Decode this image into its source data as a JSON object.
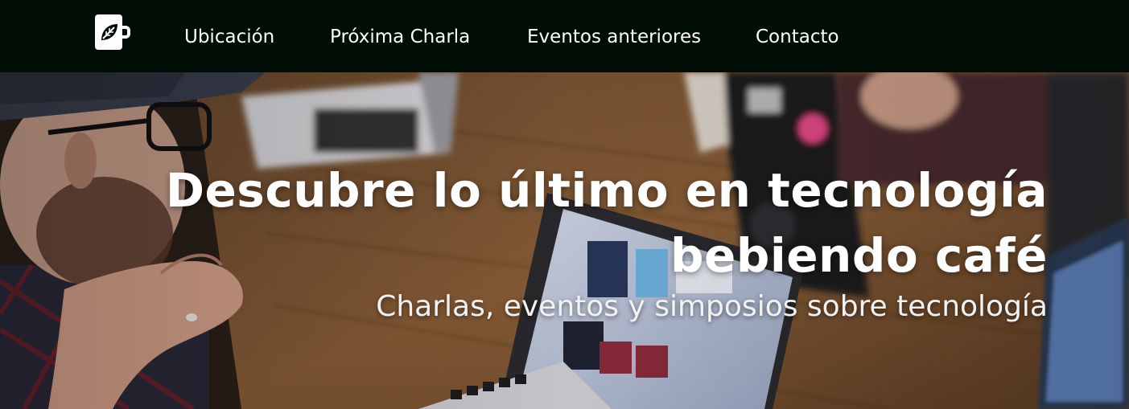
{
  "nav": {
    "logo_icon": "coffee-cup-leaf-icon",
    "links": [
      {
        "label": "Ubicación"
      },
      {
        "label": "Próxima Charla"
      },
      {
        "label": "Eventos anteriores"
      },
      {
        "label": "Contacto"
      }
    ]
  },
  "hero": {
    "title": "Descubre lo último en tecnología bebiendo café",
    "subtitle": "Charlas, eventos y simposios sobre tecnología"
  },
  "colors": {
    "navbar_bg": "#000e06",
    "text": "#ffffff"
  }
}
